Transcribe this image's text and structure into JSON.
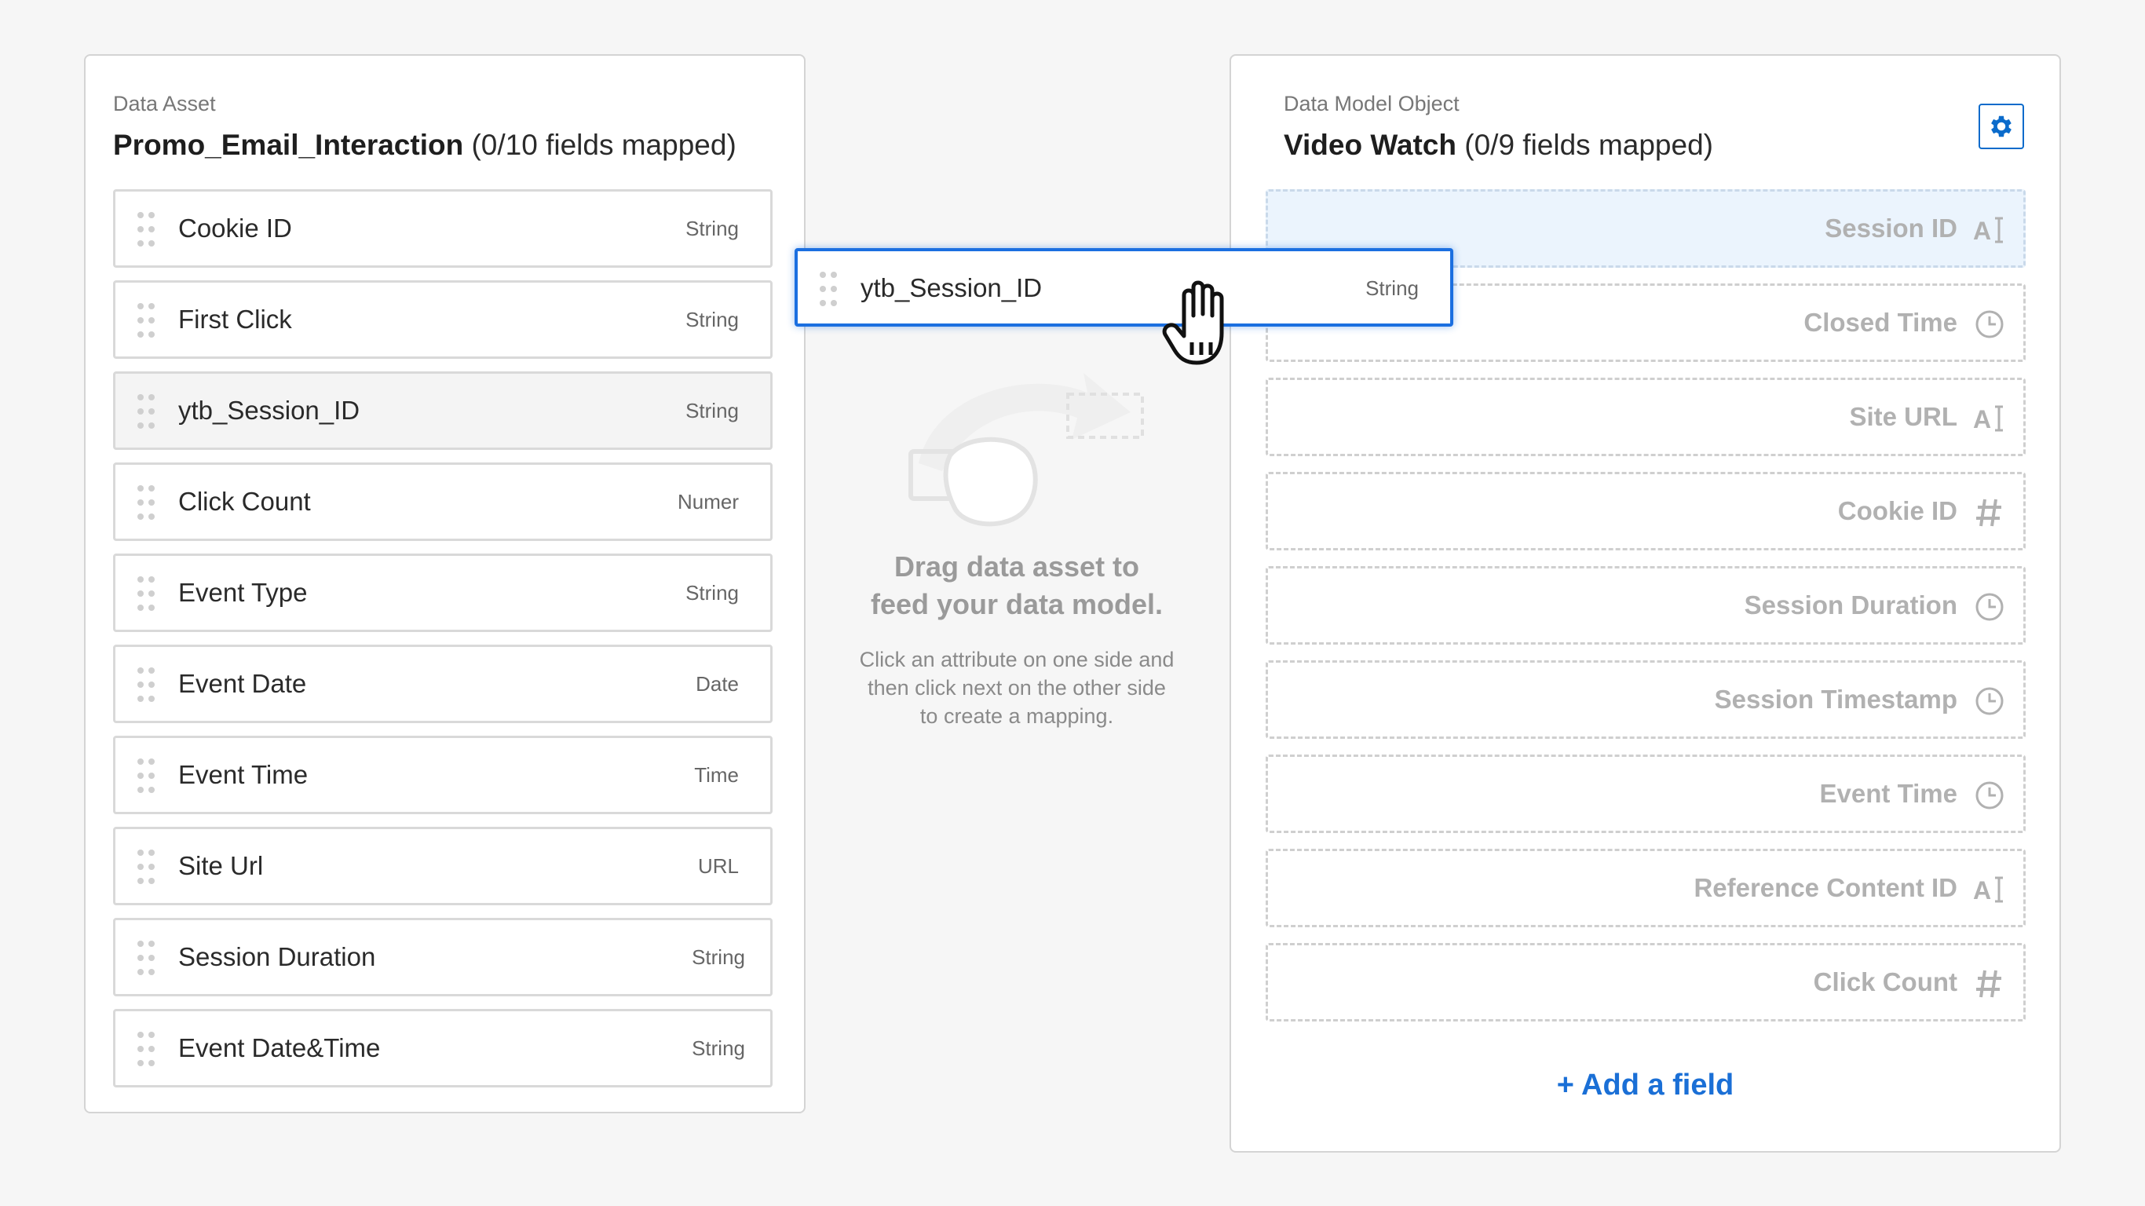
{
  "data_asset": {
    "eyebrow": "Data Asset",
    "name": "Promo_Email_Interaction",
    "mapped_count": "(0/10 fields mapped)",
    "fields": [
      {
        "name": "Cookie ID",
        "type": "String"
      },
      {
        "name": "First Click",
        "type": "String"
      },
      {
        "name": "ytb_Session_ID",
        "type": "String"
      },
      {
        "name": "Click Count",
        "type": "Numer"
      },
      {
        "name": "Event Type",
        "type": "String"
      },
      {
        "name": "Event Date",
        "type": "Date"
      },
      {
        "name": "Event Time",
        "type": "Time"
      },
      {
        "name": "Site Url",
        "type": "URL"
      },
      {
        "name": "Session Duration",
        "type": "String"
      },
      {
        "name": "Event Date&Time",
        "type": "String"
      }
    ]
  },
  "hint": {
    "title_line1": "Drag data asset to",
    "title_line2": "feed your data model.",
    "body_line1": "Click an attribute on one side and",
    "body_line2": "then click next on the other side",
    "body_line3": "to create a mapping."
  },
  "data_model": {
    "eyebrow": "Data Model Object",
    "name": "Video Watch",
    "mapped_count": "(0/9 fields mapped)",
    "fields": [
      {
        "name": "Session ID",
        "icon": "text-icon"
      },
      {
        "name": "Closed Time",
        "icon": "clock-icon"
      },
      {
        "name": "Site URL",
        "icon": "text-icon"
      },
      {
        "name": "Cookie ID",
        "icon": "number-icon"
      },
      {
        "name": "Session Duration",
        "icon": "clock-icon"
      },
      {
        "name": "Session Timestamp",
        "icon": "clock-icon"
      },
      {
        "name": "Event Time",
        "icon": "clock-icon"
      },
      {
        "name": "Reference Content ID",
        "icon": "text-icon"
      },
      {
        "name": "Click Count",
        "icon": "number-icon"
      }
    ],
    "add_field_label": "+ Add a field"
  },
  "dragging": {
    "name": "ytb_Session_ID",
    "type": "String"
  },
  "colors": {
    "accent": "#1b6fe0",
    "drop_target": "#ebf4fd",
    "muted_label": "#b1b1b1"
  }
}
